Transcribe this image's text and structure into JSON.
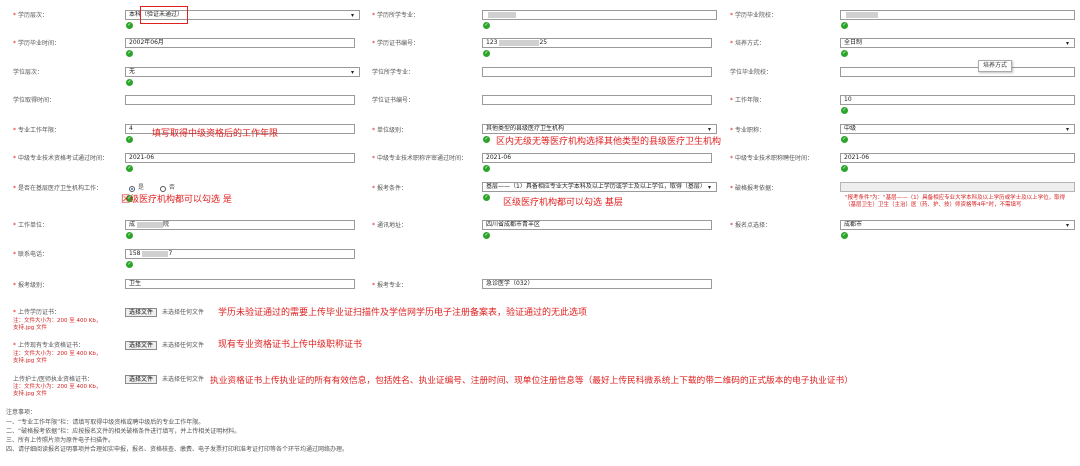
{
  "rows": {
    "r1": {
      "education_level": {
        "label": "学历层次：",
        "value": "本科（验证未通过）"
      },
      "education_major": {
        "label": "学历所学专业："
      },
      "graduation_school": {
        "label": "学历毕业院校："
      }
    },
    "r2": {
      "graduation_time": {
        "label": "学历毕业时间：",
        "value": "2002年06月"
      },
      "certificate_no": {
        "label": "学历证书编号：",
        "value_prefix": "123",
        "value_suffix": "25"
      },
      "training_mode": {
        "label": "培养方式：",
        "value": "全日制"
      }
    },
    "r3": {
      "degree_level": {
        "label": "学位层次：",
        "value": "无"
      },
      "degree_major": {
        "label": "学位所学专业："
      },
      "degree_school": {
        "label": "学位毕业院校："
      }
    },
    "r4": {
      "degree_time": {
        "label": "学位取得时间："
      },
      "degree_cert_no": {
        "label": "学位证书编号："
      },
      "work_years": {
        "label": "工作年限：",
        "value": "10"
      }
    },
    "r5": {
      "major_work_years": {
        "label": "专业工作年限：",
        "value": "4"
      },
      "unit_level": {
        "label": "单位级别：",
        "value": "其他类型的县级医疗卫生机构"
      },
      "professional_title": {
        "label": "专业职称：",
        "value": "中级"
      }
    },
    "r6": {
      "qual_exam_time": {
        "label": "中级专业技术资格考试通过时间：",
        "value": "2021-06"
      },
      "title_review_time": {
        "label": "中级专业技术职称评审通过时间：",
        "value": "2021-06"
      },
      "title_hire_time": {
        "label": "中级专业技术职称聘任时间：",
        "value": "2021-06"
      }
    },
    "r7": {
      "grassroots": {
        "label": "是否在基层医疗卫生机构工作：",
        "yes": "是",
        "no": "否"
      },
      "exam_condition": {
        "label": "报考条件：",
        "value": "基层——（1）具备相应专业大学本科及以上学历或学士及以上学位，取得（基层）"
      },
      "qualification_basis": {
        "label": "破格报考依据：",
        "hint": "\"报考条件\"为：\"基层——（1）具备相应专业大学本科及以上学历或学士及以上学位，取得（基层卫生）卫生（主治）医（药、护、技）师资格等4年\"时，不需填写"
      }
    },
    "r8": {
      "work_unit": {
        "label": "工作单位：",
        "value_prefix": "成",
        "value_suffix": "院"
      },
      "address": {
        "label": "通讯地址：",
        "value": "四川省成都市青羊区"
      },
      "exam_area": {
        "label": "报名点选择：",
        "value": "成都市"
      }
    },
    "r9": {
      "phone": {
        "label": "联系电话：",
        "value_prefix": "158",
        "value_suffix": "7"
      }
    },
    "r10": {
      "exam_level": {
        "label": "报考级别：",
        "value": "卫生"
      },
      "exam_major": {
        "label": "报考专业：",
        "value": "急诊医学（032）"
      }
    }
  },
  "uploads": [
    {
      "label": "上传学历证书：",
      "hint1": "注：文件大小为：200 至 400 Kb，",
      "hint2": "支持.jpg 文件",
      "button": "选择文件",
      "nofile": "未选择任何文件",
      "note": "学历未验证通过的需要上传毕业证扫描件及学信网学历电子注册备案表，验证通过的无此选项"
    },
    {
      "label": "上传现有专业资格证书：",
      "hint1": "注：文件大小为：200 至 400 Kb，",
      "hint2": "支持.jpg 文件",
      "button": "选择文件",
      "nofile": "未选择任何文件",
      "note": "现有专业资格证书上传中级职称证书"
    },
    {
      "label": "上传护士/医师执业资格证书：",
      "hint1": "注：文件大小为：200 至 400 Kb，",
      "hint2": "支持.jpg 文件",
      "button": "选择文件",
      "nofile": "未选择任何文件",
      "note": "执业资格证书上传执业证的所有有效信息，包括姓名、执业证编号、注册时间、现单位注册信息等（最好上传民科微系统上下载的带二维码的正式版本的电子执业证书）"
    }
  ],
  "annotations": {
    "work_years_note": "填写取得中级资格后的工作年限",
    "unit_level_note": "区内无级无等医疗机构选择其他类型的县级医疗卫生机构",
    "grassroots_note": "区级医疗机构都可以勾选 是",
    "exam_condition_note": "区级医疗机构都可以勾选 基层"
  },
  "tooltip": "培养方式",
  "notes": {
    "title": "注意事项：",
    "items": [
      "一、“专业工作年限”栏：请填写取得中级资格或聘中级后的专业工作年限。",
      "二、“破格报考依据”栏：应按报名文件的相关破格条件进行填写，并上传相关证明材料。",
      "三、所有上传照片须为原件电子扫描件。",
      "四、请仔细阅读报名证明事项并合理如实申报，报名、资格核查、缴费、电子发票打印和准考证打印等各个环节均通过网络办理。"
    ]
  },
  "colors": {
    "red": "#e02020",
    "ok": "#2aa52a"
  }
}
